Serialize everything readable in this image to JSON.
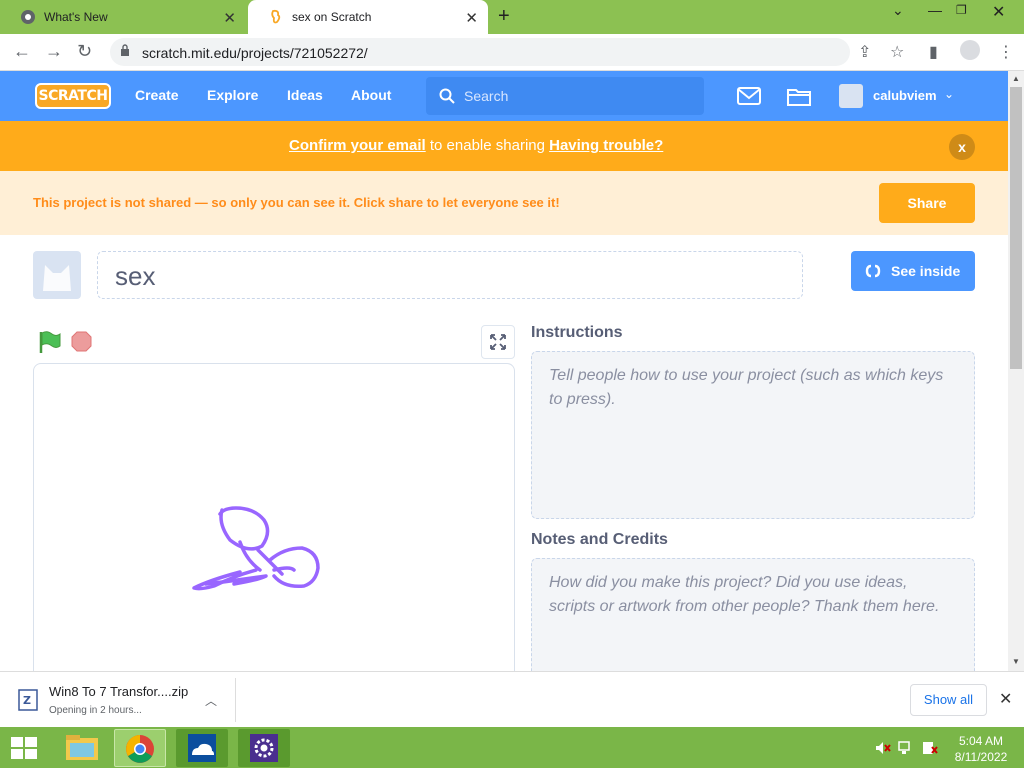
{
  "browser": {
    "tabs": [
      {
        "title": "What's New",
        "active": false
      },
      {
        "title": "sex on Scratch",
        "active": true
      }
    ],
    "url": "scratch.mit.edu/projects/721052272/"
  },
  "nav": {
    "logo": "SCRATCH",
    "links": [
      "Create",
      "Explore",
      "Ideas",
      "About"
    ],
    "search_placeholder": "Search",
    "username": "calubviem"
  },
  "banner": {
    "confirm_link": "Confirm your email",
    "middle_text": " to enable sharing ",
    "trouble_link": "Having trouble?",
    "close_label": "x"
  },
  "not_shared": {
    "message": "This project is not shared — so only you can see it. Click share to let everyone see it!",
    "share_label": "Share"
  },
  "project": {
    "title": "sex",
    "see_inside_label": "See inside"
  },
  "instructions": {
    "heading": "Instructions",
    "placeholder": "Tell people how to use your project (such as which keys to press)."
  },
  "notes": {
    "heading": "Notes and Credits",
    "placeholder": "How did you make this project? Did you use ideas, scripts or artwork from other people? Thank them here."
  },
  "download": {
    "filename": "Win8 To 7 Transfor....zip",
    "status": "Opening in 2 hours...",
    "show_all_label": "Show all"
  },
  "taskbar": {
    "time": "5:04 AM",
    "date": "8/11/2022"
  },
  "colors": {
    "scratch_blue": "#4c97ff",
    "banner_orange": "#ffab1a",
    "taskbar_green": "#7ab648",
    "sprite_purple": "#9966ff"
  }
}
